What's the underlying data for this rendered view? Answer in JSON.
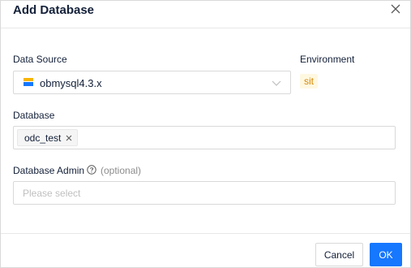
{
  "dialog": {
    "title": "Add Database",
    "close_icon": "close-icon"
  },
  "data_source": {
    "label": "Data Source",
    "value": "obmysql4.3.x",
    "icon": "datasource-icon"
  },
  "environment": {
    "label": "Environment",
    "value": "sit"
  },
  "database": {
    "label": "Database",
    "tags": [
      "odc_test"
    ]
  },
  "database_admin": {
    "label": "Database Admin",
    "optional_text": "(optional)",
    "placeholder": "Please select"
  },
  "footer": {
    "cancel_label": "Cancel",
    "ok_label": "OK"
  },
  "colors": {
    "primary": "#1677ff",
    "env_badge_bg": "#fff8e1",
    "env_badge_text": "#d48806"
  }
}
